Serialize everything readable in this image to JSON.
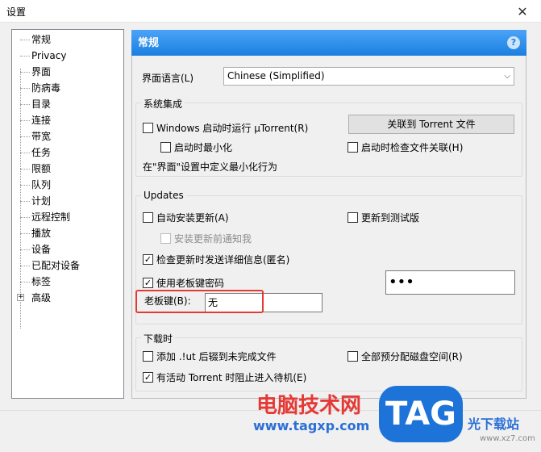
{
  "window": {
    "title": "设置",
    "close": "✕"
  },
  "tree": {
    "items": [
      "常规",
      "Privacy",
      "界面",
      "防病毒",
      "目录",
      "连接",
      "带宽",
      "任务",
      "限额",
      "队列",
      "计划",
      "远程控制",
      "播放",
      "设备",
      "已配对设备",
      "标签",
      "高级"
    ]
  },
  "header": {
    "title": "常规",
    "help": "?"
  },
  "language": {
    "label": "界面语言(L)",
    "value": "Chinese (Simplified)"
  },
  "system": {
    "title": "系统集成",
    "run_at_startup": "Windows 启动时运行 µTorrent(R)",
    "start_minimized": "启动时最小化",
    "associate_button": "关联到 Torrent 文件",
    "check_assoc": "启动时检查文件关联(H)",
    "minimize_note": "在\"界面\"设置中定义最小化行为"
  },
  "updates": {
    "title": "Updates",
    "auto_install": "自动安装更新(A)",
    "beta": "更新到测试版",
    "notify_before": "安装更新前通知我",
    "send_info": "检查更新时发送详细信息(匿名)",
    "use_boss_password": "使用老板键密码",
    "password_value": "•••",
    "boss_key_label": "老板键(B):",
    "boss_key_value": "无"
  },
  "download": {
    "title": "下载时",
    "append_ut": "添加 .!ut 后辍到未完成文件",
    "prealloc": "全部预分配磁盘空间(R)",
    "prevent_standby": "有活动 Torrent 时阻止进入待机(E)"
  },
  "watermark": {
    "cn": "电脑技术网",
    "url": "www.tagxp.com",
    "tag": "TAG",
    "site": "光下载站",
    "site2": "www.xz7.com"
  }
}
